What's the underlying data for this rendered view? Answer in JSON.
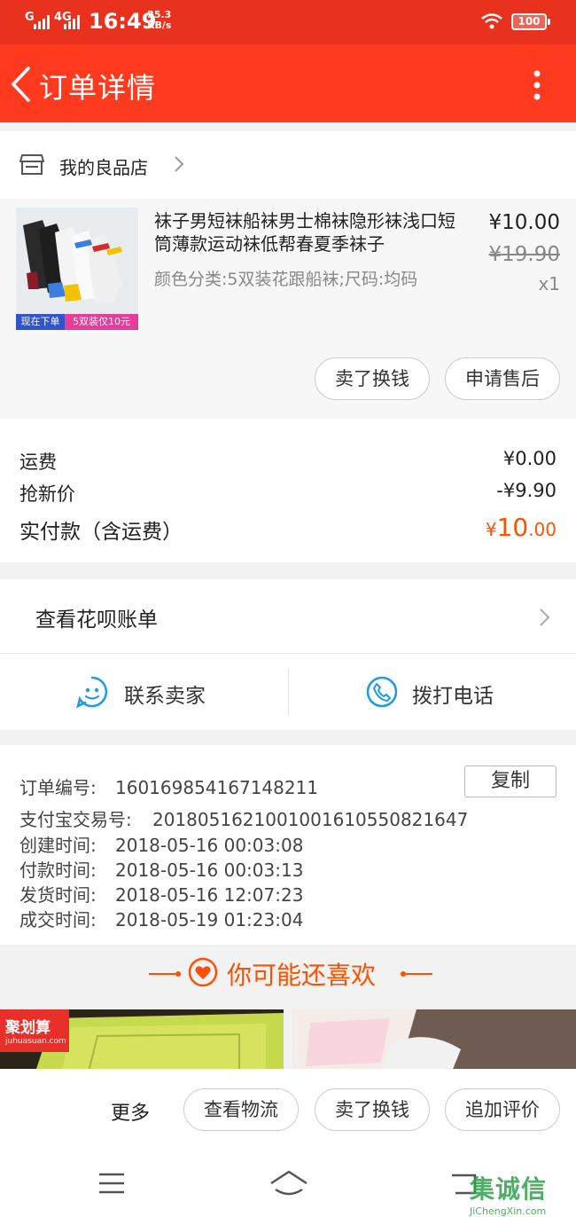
{
  "status_bar": {
    "signal_1": "G",
    "signal_2": "4G",
    "time": "16:49",
    "speed_value": "25.3",
    "speed_unit": "KB/s",
    "battery": "100"
  },
  "header": {
    "title": "订单详情"
  },
  "store": {
    "name": "我的良品店"
  },
  "product": {
    "title": "袜子男短袜船袜男士棉袜隐形袜浅口短筒薄款运动袜低帮春夏季袜子",
    "spec": "颜色分类:5双装花跟船袜;尺码:均码",
    "price": "¥10.00",
    "original_price": "¥19.90",
    "quantity": "x1",
    "thumb_tag_left": "现在下单",
    "thumb_tag_right": "5双装仅10元"
  },
  "product_actions": {
    "sell_label": "卖了换钱",
    "aftersale_label": "申请售后"
  },
  "costs": {
    "shipping_label": "运费",
    "shipping_value": "¥0.00",
    "discount_label": "抢新价",
    "discount_value": "-¥9.90",
    "paid_label": "实付款（含运费）",
    "paid_currency": "¥",
    "paid_int": "10",
    "paid_dec": ".00"
  },
  "huabei": {
    "label": "查看花呗账单"
  },
  "contact": {
    "seller_label": "联系卖家",
    "phone_label": "拨打电话"
  },
  "order_info": {
    "copy_label": "复制",
    "rows": [
      {
        "key": "订单编号:",
        "value": "160169854167148211"
      },
      {
        "key": "支付宝交易号:",
        "value": "2018051621001001610550821647"
      },
      {
        "key": "创建时间:",
        "value": "2018-05-16 00:03:08"
      },
      {
        "key": "付款时间:",
        "value": "2018-05-16 00:03:13"
      },
      {
        "key": "发货时间:",
        "value": "2018-05-16 12:07:23"
      },
      {
        "key": "成交时间:",
        "value": "2018-05-19 01:23:04"
      }
    ]
  },
  "recommend": {
    "heading": "你可能还喜欢",
    "badge_cn": "聚划算",
    "badge_en": "juhuasuan.com"
  },
  "bottom_bar": {
    "more_label": "更多",
    "logistics_label": "查看物流",
    "sell_label": "卖了换钱",
    "review_label": "追加评价"
  },
  "watermark": {
    "cn": "集诚信",
    "en": "JiChengXin.com"
  },
  "colors": {
    "header_red": "#ff3a1f",
    "status_red": "#e8321d",
    "accent_orange": "#ff5000",
    "icon_blue": "#1e9be8"
  }
}
